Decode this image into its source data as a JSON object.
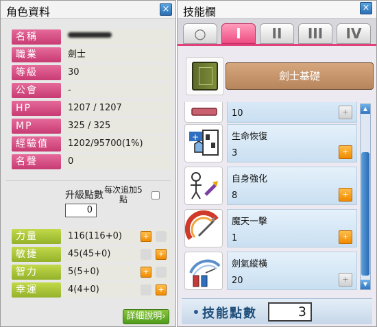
{
  "character_window": {
    "title": "角色資料",
    "close_icon": "×",
    "info": [
      {
        "label": "名稱",
        "value": ""
      },
      {
        "label": "職業",
        "value": "劍士"
      },
      {
        "label": "等級",
        "value": "30"
      },
      {
        "label": "公會",
        "value": "-"
      },
      {
        "label": "HP",
        "value": "1207 / 1207"
      },
      {
        "label": "MP",
        "value": "325 / 325"
      },
      {
        "label": "經驗值",
        "value": "1202/95700(1%)"
      },
      {
        "label": "名聲",
        "value": "0"
      }
    ],
    "level_up": {
      "label": "升級點數",
      "value": "0",
      "auto_note": "每次追加5點"
    },
    "stats": [
      {
        "label": "力量",
        "value": "116(116+0)",
        "plus_active": true
      },
      {
        "label": "敏捷",
        "value": "45(45+0)",
        "plus_active": true
      },
      {
        "label": "智力",
        "value": "5(5+0)",
        "plus_active": true
      },
      {
        "label": "幸運",
        "value": "4(4+0)",
        "plus_active": true
      }
    ],
    "plus_icon": "+",
    "detail_button": "詳細說明›"
  },
  "skill_window": {
    "title": "技能欄",
    "close_icon": "×",
    "tabs": [
      {
        "label": "○",
        "active": false
      },
      {
        "label": "I",
        "active": true
      },
      {
        "label": "II",
        "active": false
      },
      {
        "label": "III",
        "active": false
      },
      {
        "label": "IV",
        "active": false
      }
    ],
    "job": "劍士基礎",
    "skills": [
      {
        "name": "",
        "level": "10",
        "up_active": false,
        "icon": "partial-skill-icon"
      },
      {
        "name": "生命恢復",
        "level": "3",
        "up_active": true,
        "icon": "hp-recovery-icon"
      },
      {
        "name": "自身強化",
        "level": "8",
        "up_active": true,
        "icon": "self-buff-icon"
      },
      {
        "name": "魔天一擊",
        "level": "1",
        "up_active": true,
        "icon": "power-strike-icon"
      },
      {
        "name": "劍氣縱橫",
        "level": "20",
        "up_active": false,
        "icon": "slash-blast-icon"
      }
    ],
    "up_icon": "+",
    "scroll_up": "▲",
    "scroll_down": "▼",
    "skill_points_label": "技能點數",
    "skill_points": "3"
  },
  "colors": {
    "info_label": "#d84f84",
    "stat_label": "#aac63a",
    "plus_button": "#f08a00",
    "tab_active": "#ee4c83",
    "job_banner": "#c6956b",
    "skill_info_bg": "#d8e8f6"
  }
}
